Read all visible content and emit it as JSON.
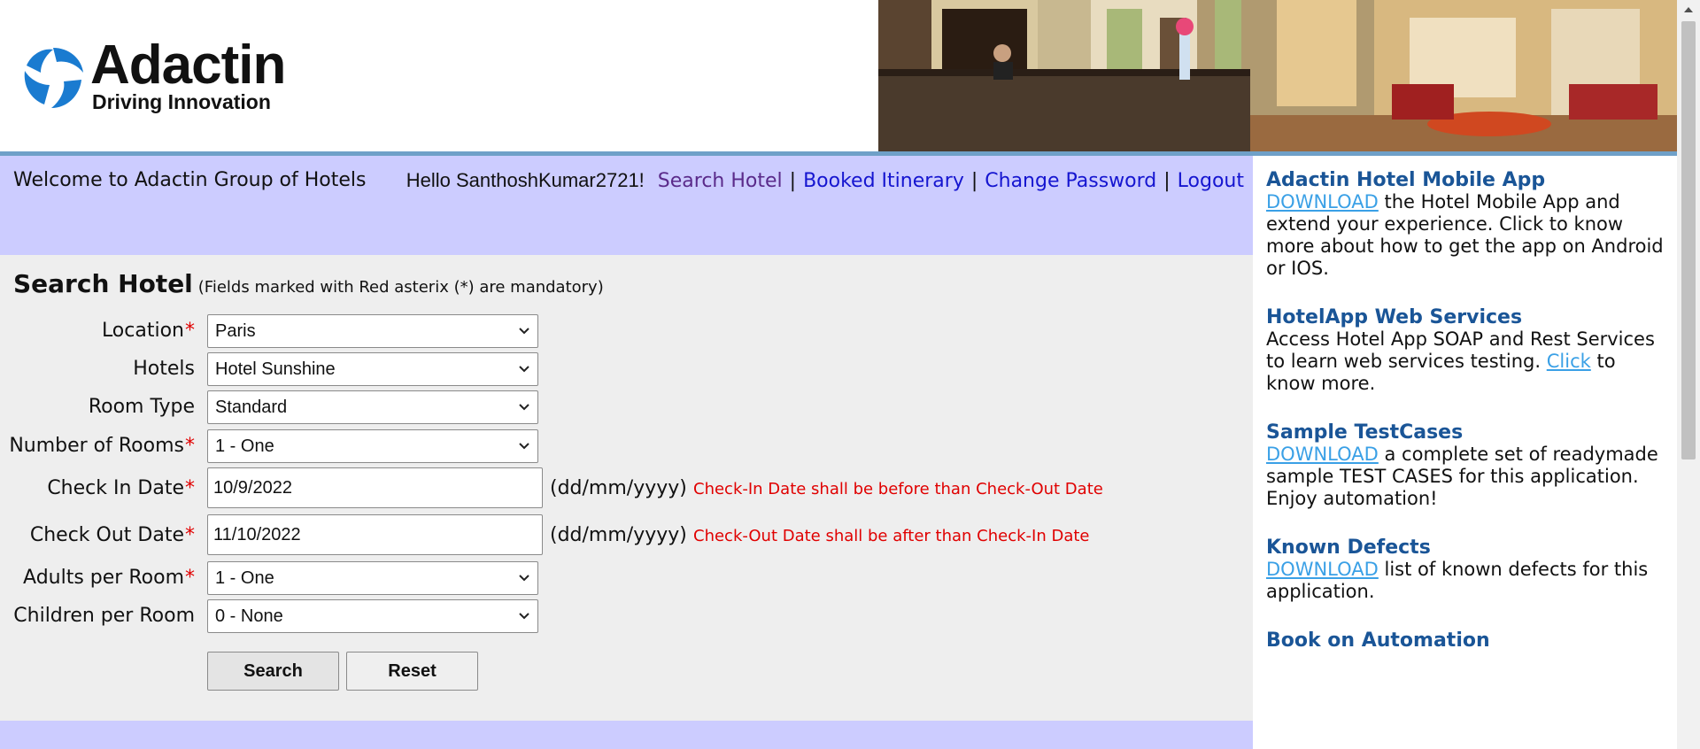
{
  "brand": {
    "name": "Adactin",
    "tagline": "Driving Innovation"
  },
  "nav": {
    "welcome": "Welcome to Adactin Group of Hotels",
    "greeting": "Hello SanthoshKumar2721!",
    "search_hotel": "Search Hotel",
    "booked_itinerary": "Booked Itinerary",
    "change_password": "Change Password",
    "logout": "Logout",
    "separator": "|"
  },
  "form": {
    "title": "Search Hotel",
    "note": "(Fields marked with Red asterix (*) are mandatory)",
    "required_mark": "*",
    "location": {
      "label": "Location",
      "value": "Paris"
    },
    "hotels": {
      "label": "Hotels",
      "value": "Hotel Sunshine"
    },
    "room_type": {
      "label": "Room Type",
      "value": "Standard"
    },
    "rooms": {
      "label": "Number of Rooms",
      "value": "1 - One"
    },
    "checkin": {
      "label": "Check In Date",
      "value": "10/9/2022",
      "format": "(dd/mm/yyyy)",
      "error": "Check-In Date shall be before than Check-Out Date"
    },
    "checkout": {
      "label": "Check Out Date",
      "value": "11/10/2022",
      "format": "(dd/mm/yyyy)",
      "error": "Check-Out Date shall be after than Check-In Date"
    },
    "adults": {
      "label": "Adults per Room",
      "value": "1 - One"
    },
    "children": {
      "label": "Children per Room",
      "value": "0 - None"
    },
    "search_button": "Search",
    "reset_button": "Reset"
  },
  "sidebar": {
    "mobile_app": {
      "title": "Adactin Hotel Mobile App",
      "link": "DOWNLOAD",
      "text": " the Hotel Mobile App and extend your experience. Click to know more about how to get the app on Android or IOS."
    },
    "web_services": {
      "title": "HotelApp Web Services",
      "text_before": "Access Hotel App SOAP and Rest Services to learn web services testing. ",
      "link": "Click",
      "text_after": " to know more."
    },
    "test_cases": {
      "title": "Sample TestCases",
      "link": "DOWNLOAD",
      "text": " a complete set of readymade sample TEST CASES for this application. Enjoy automation!"
    },
    "known_defects": {
      "title": "Known Defects",
      "link": "DOWNLOAD",
      "text": " list of known defects for this application."
    },
    "book": {
      "title": "Book on Automation"
    }
  },
  "colors": {
    "nav_band": "#ccccff",
    "form_bg": "#eeeeee",
    "error_red": "#e00000",
    "link_blue": "#1515d0",
    "sidebar_title": "#1a5597",
    "sidebar_link": "#3aa0e6",
    "logo_blue": "#1a7bd0"
  },
  "icons": {
    "logo": "adactin-swirl-icon",
    "dropdown": "chevron-down-icon",
    "scroll_up": "triangle-up-icon"
  }
}
